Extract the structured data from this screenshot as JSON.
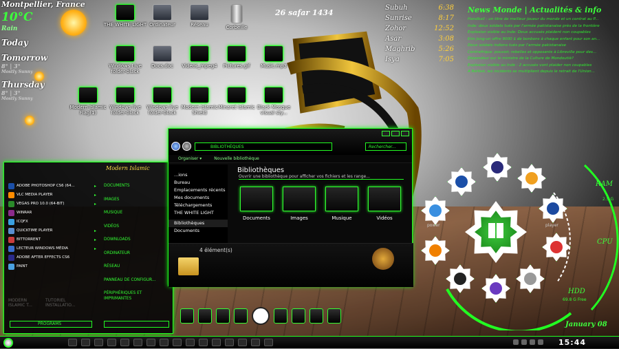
{
  "weather": {
    "location": "Montpellier, France",
    "temp": "10°C",
    "condition": "Rain",
    "days": [
      {
        "name": "Today",
        "range": "",
        "cond": ""
      },
      {
        "name": "Tomorrow",
        "range": "8° | 3°",
        "cond": "Mostly Sunny"
      },
      {
        "name": "Thursday",
        "range": "8° | 3°",
        "cond": "Mostly Sunny"
      }
    ]
  },
  "date": "26 safar 1434",
  "prayers": [
    {
      "name": "Subuh",
      "time": "6:38"
    },
    {
      "name": "Sunrise",
      "time": "8:17"
    },
    {
      "name": "Zohor",
      "time": "12:52"
    },
    {
      "name": "Asar",
      "time": "3:08"
    },
    {
      "name": "Maghrib",
      "time": "5:26"
    },
    {
      "name": "Isya",
      "time": "7:05"
    }
  ],
  "news": {
    "title": "News Monde | Actualités & info",
    "items": [
      "Handball : un titre de meilleur joueur du monde et un contrat au P...",
      "Inde: deux soldats tués par l'armée pakistanaise près de la frontière",
      "Explosion visible au Inde: Deux accusés plaident non coupables",
      "Kim Jong-un offre 9000 $ de bonbons à chaque enfant pour son an...",
      "Deux soldats indiens tués par l'armée pakistanaise",
      "Centrafrique: pouvoir, rebelles et opposants à Libreville pour des...",
      "Dépendeur sur le ministre de la Culture de Mondoutiè?",
      "Explosion visible au Inde : 2 accusés vont plaider non coupables",
      "A Belfast, les incidents se multiplient depuis le retrait de l'Union..."
    ]
  },
  "desktop_icons": [
    {
      "label": "THE WHITE LIGHT",
      "kind": "bag"
    },
    {
      "label": "Ordinateur",
      "kind": "doc"
    },
    {
      "label": "Réseau",
      "kind": "doc"
    },
    {
      "label": "Corbeille",
      "kind": "can"
    },
    {
      "label": "Windows Live folder-black",
      "kind": "bag"
    },
    {
      "label": "Docs.doc",
      "kind": "doc"
    },
    {
      "label": "Videos_mpeg4",
      "kind": "bag"
    },
    {
      "label": "Pictures.gif",
      "kind": "bag"
    },
    {
      "label": "Music.mp3",
      "kind": "bag"
    },
    {
      "label": "Modern Islamic Flag(1)",
      "kind": "bag"
    },
    {
      "label": "Windows live folder-black",
      "kind": "bag"
    },
    {
      "label": "Windows live folder-black",
      "kind": "bag"
    },
    {
      "label": "Modern Islamic Shield",
      "kind": "bag"
    },
    {
      "label": "Minaret Islamic",
      "kind": "bag"
    },
    {
      "label": "Black Mosque visual sty...",
      "kind": "bag"
    }
  ],
  "explorer": {
    "address": "BIBLIOTHÈQUES",
    "search_placeholder": "Rechercher...",
    "organize": "Organiser ▾",
    "new_library": "Nouvelle bibliothèque",
    "nav": [
      "...ions",
      "Bureau",
      "Emplacements récents",
      "Mes documents",
      "Téléchargements",
      "THE WHITE LIGHT",
      "Bibliothèques",
      "Documents"
    ],
    "title": "Bibliothèques",
    "subtitle": "Ouvrir une bibliothèque pour afficher vos fichiers et les range...",
    "libraries": [
      {
        "label": "Documents"
      },
      {
        "label": "Images"
      },
      {
        "label": "Musique"
      },
      {
        "label": "Vidéos"
      }
    ],
    "status": "4 élément(s)"
  },
  "start": {
    "logo": "Modern Islamic",
    "programs": [
      {
        "label": "ADOBE PHOTOSHOP CS6 (64...",
        "color": "#1b4fa8",
        "arrow": true
      },
      {
        "label": "VLC MEDIA PLAYER",
        "color": "#ff8c00",
        "arrow": true
      },
      {
        "label": "VEGAS PRO 10.0 (64-BIT)",
        "color": "#2a8a2a",
        "arrow": true
      },
      {
        "label": "WINRAR",
        "color": "#8b2a8b",
        "arrow": false
      },
      {
        "label": "ICQFX",
        "color": "#3aa0e0",
        "arrow": false
      },
      {
        "label": "QUICKTIME PLAYER",
        "color": "#5a8fd0",
        "arrow": true
      },
      {
        "label": "BITTORRENT",
        "color": "#c93c3c",
        "arrow": true
      },
      {
        "label": "LECTEUR WINDOWS MÉDIA",
        "color": "#3a6fd0",
        "arrow": true
      },
      {
        "label": "ADOBE AFTER EFFECTS CS6",
        "color": "#2a2a8a",
        "arrow": false
      },
      {
        "label": "PAINT",
        "color": "#4aa0e0",
        "arrow": false
      }
    ],
    "places": [
      "DOCUMENTS",
      "IMAGES",
      "MUSIQUE",
      "VIDÉOS",
      "DOWNLOADS",
      "ORDINATEUR",
      "RÉSEAU",
      "PANNEAU DE CONFIGUR...",
      "PÉRIPHÉRIQUES ET IMPRIMANTES"
    ],
    "dim": [
      "MODERN ISLAMIC T...",
      "TUTORIEL INSTALLATIO..."
    ],
    "programs_btn": "PROGRAMS"
  },
  "gadget": {
    "ram": "RAM",
    "ram_val": "2.5 G",
    "cpu": "CPU",
    "hdd": "HDD",
    "hdd_free": "69.8 G Free",
    "power": "power",
    "player": "player",
    "month": "January 08"
  },
  "taskbar": {
    "clock": "15:44"
  }
}
